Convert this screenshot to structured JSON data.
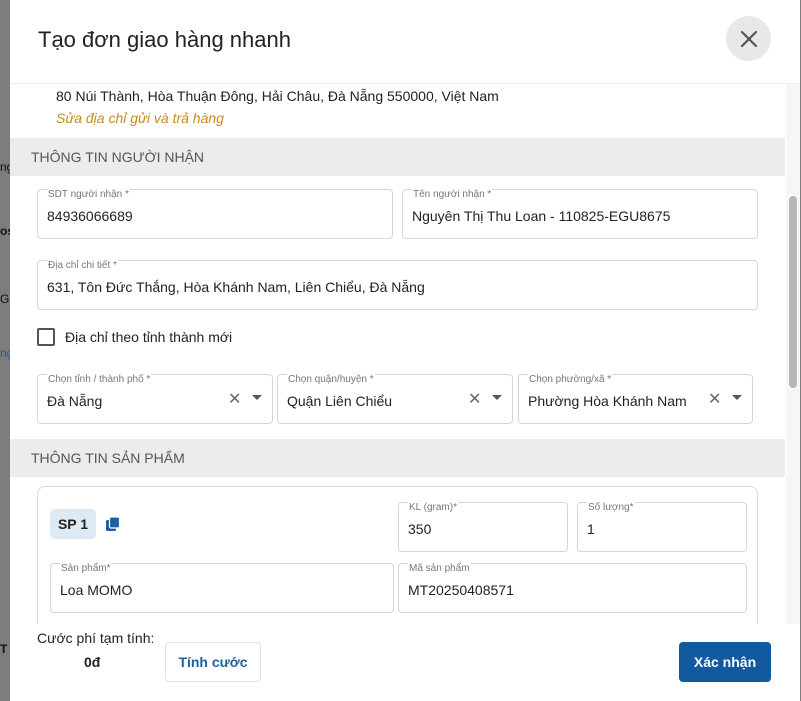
{
  "backdrop": {
    "fragments": [
      "ng",
      "os",
      "G",
      "ng",
      "T"
    ]
  },
  "dialog": {
    "title": "Tạo đơn giao hàng nhanh",
    "close_icon": "close-icon"
  },
  "sender": {
    "address": "80 Núi Thành, Hòa Thuận Đông, Hải Châu, Đà Nẵng 550000, Việt Nam",
    "edit_link": "Sửa địa chỉ gửi và trả hàng"
  },
  "recipient": {
    "section_title": "THÔNG TIN NGƯỜI NHẬN",
    "phone": {
      "label": "SDT người nhận *",
      "value": "84936066689"
    },
    "name": {
      "label": "Tên người nhận *",
      "value": "Nguyên Thị Thu Loan - 110825-EGU8675"
    },
    "address": {
      "label": "Địa chỉ chi tiết *",
      "value": "631, Tôn Đức Thắng, Hòa Khánh Nam, Liên Chiểu, Đà Nẵng"
    },
    "new_province_checkbox": {
      "label": "Địa chỉ theo tỉnh thành mới",
      "checked": false
    },
    "province": {
      "label": "Chọn tỉnh / thành phố *",
      "value": "Đà Nẵng"
    },
    "district": {
      "label": "Chọn quận/huyện *",
      "value": "Quận Liên Chiểu"
    },
    "ward": {
      "label": "Chọn phường/xã *",
      "value": "Phường Hòa Khánh Nam"
    }
  },
  "product": {
    "section_title": "THÔNG TIN SẢN PHẨM",
    "badge": "SP 1",
    "weight": {
      "label": "KL (gram)*",
      "value": "350"
    },
    "quantity": {
      "label": "Số lượng*",
      "value": "1"
    },
    "name": {
      "label": "Sản phẩm*",
      "value": "Loa MOMO"
    },
    "code": {
      "label": "Mã sản phẩm",
      "value": "MT20250408571"
    }
  },
  "footer": {
    "fee_label": "Cước phí tạm tính:",
    "fee_value": "0đ",
    "calc_button": "Tính cước",
    "confirm_button": "Xác nhận"
  },
  "colors": {
    "accent": "#12599f",
    "link_orange": "#c98a1d",
    "section_bg": "#ececec"
  }
}
